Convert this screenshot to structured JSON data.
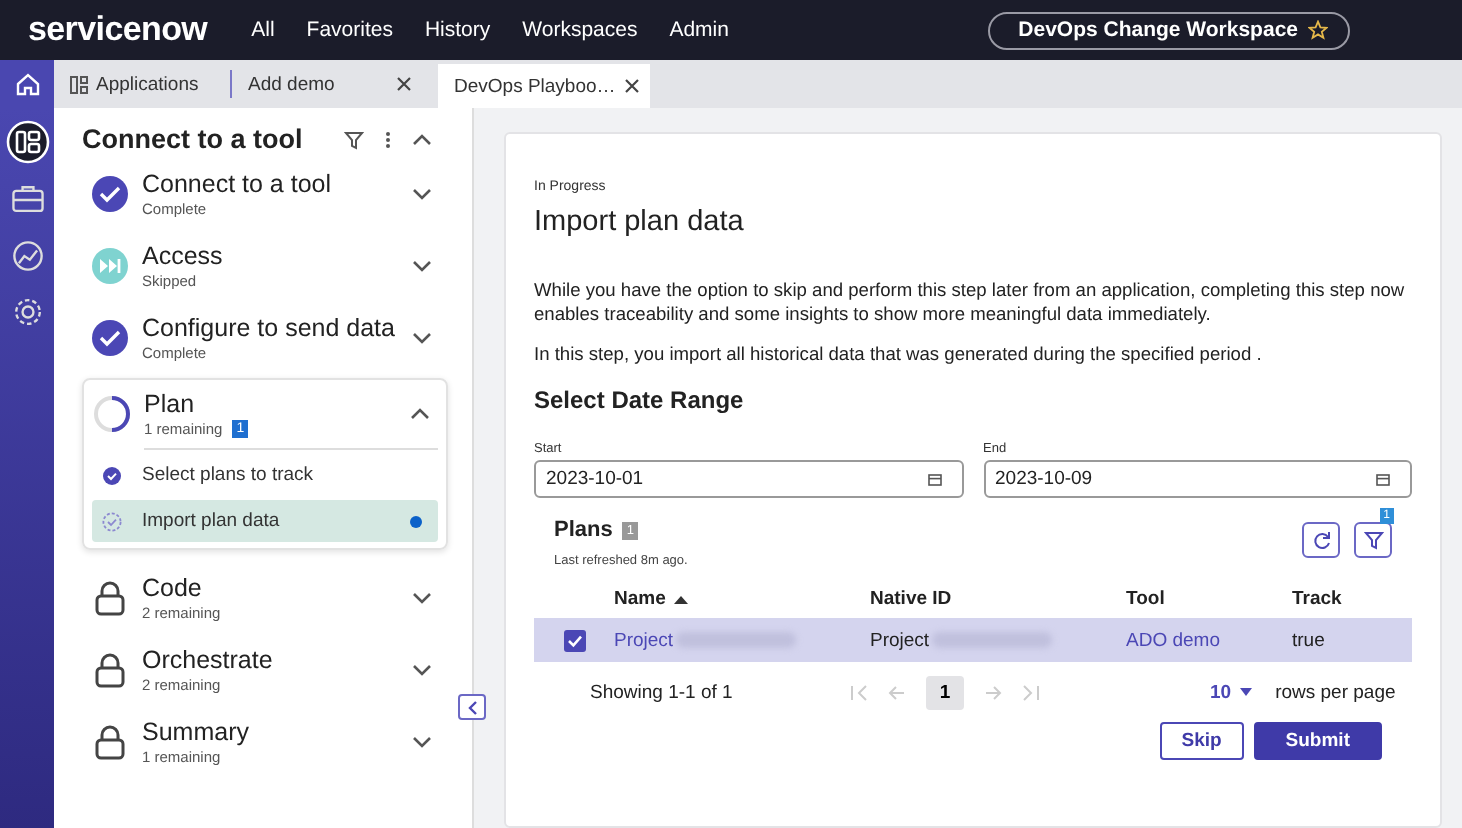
{
  "top_bar": {
    "logo": "servicenow",
    "nav": [
      "All",
      "Favorites",
      "History",
      "Workspaces",
      "Admin"
    ],
    "workspace_button": "DevOps Change Workspace"
  },
  "rail": [
    {
      "kind": "apps",
      "selected": true
    },
    {
      "kind": "toolbox",
      "selected": false
    },
    {
      "kind": "gauge",
      "selected": false
    },
    {
      "kind": "gear",
      "selected": false
    }
  ],
  "tabs": [
    {
      "label": "Applications",
      "kind": "apps",
      "selected": false,
      "closable": false
    },
    {
      "label": "Add demo",
      "kind": "page",
      "selected": false,
      "closable": true
    },
    {
      "label": "DevOps Playboo…",
      "kind": "page",
      "selected": true,
      "closable": true
    }
  ],
  "sidebar": {
    "title": "Connect to a tool",
    "steps": [
      {
        "title": "Connect to a tool",
        "status": "Complete",
        "kind": "complete",
        "expanded": false
      },
      {
        "title": "Access",
        "status": "Skipped",
        "kind": "skipped",
        "expanded": false
      },
      {
        "title": "Configure to send data",
        "status": "Complete",
        "kind": "complete",
        "expanded": false
      },
      {
        "title": "Plan",
        "status": "1 remaining",
        "badge": "1",
        "kind": "in_progress",
        "expanded": true,
        "children": [
          {
            "title": "Select plans to track",
            "kind": "done",
            "selected": false
          },
          {
            "title": "Import plan data",
            "kind": "current",
            "selected": true
          }
        ]
      },
      {
        "title": "Code",
        "status": "2 remaining",
        "kind": "locked",
        "expanded": false
      },
      {
        "title": "Orchestrate",
        "status": "2 remaining",
        "kind": "locked",
        "expanded": false
      },
      {
        "title": "Summary",
        "status": "1 remaining",
        "kind": "locked",
        "expanded": false
      }
    ]
  },
  "main": {
    "status": "In Progress",
    "title": "Import plan data",
    "paragraphs": [
      "While you have the option to skip and perform this step later from an application, completing this step now enables traceability and some insights to show more meaningful data immediately.",
      "In this step, you import all historical data that was generated during the specified period ."
    ],
    "section_title": "Select Date Range",
    "fields": [
      {
        "label": "Start",
        "value": "2023-10-01"
      },
      {
        "label": "End",
        "value": "2023-10-09"
      }
    ],
    "plans": {
      "title": "Plans",
      "count": "1",
      "subtitle": "Last refreshed 8m ago.",
      "filter_badge": "1",
      "columns": [
        {
          "label": "Name",
          "sorted": true
        },
        {
          "label": "Native ID",
          "sorted": false
        },
        {
          "label": "Tool",
          "sorted": false
        },
        {
          "label": "Track",
          "sorted": false
        }
      ],
      "rows": [
        {
          "selected": true,
          "checked": true,
          "cells": [
            {
              "text": "Project",
              "link": true,
              "blurred": true
            },
            {
              "text": "Project",
              "link": false,
              "blurred": true
            },
            {
              "text": "ADO demo",
              "link": true,
              "blurred": false
            },
            {
              "text": "true",
              "link": false,
              "blurred": false
            }
          ]
        }
      ],
      "showing": "Showing 1-1 of 1",
      "page": "1",
      "page_size": "10",
      "page_size_label": "rows per page"
    },
    "buttons": [
      {
        "label": "Skip",
        "kind": "secondary"
      },
      {
        "label": "Submit",
        "kind": "primary"
      }
    ]
  }
}
